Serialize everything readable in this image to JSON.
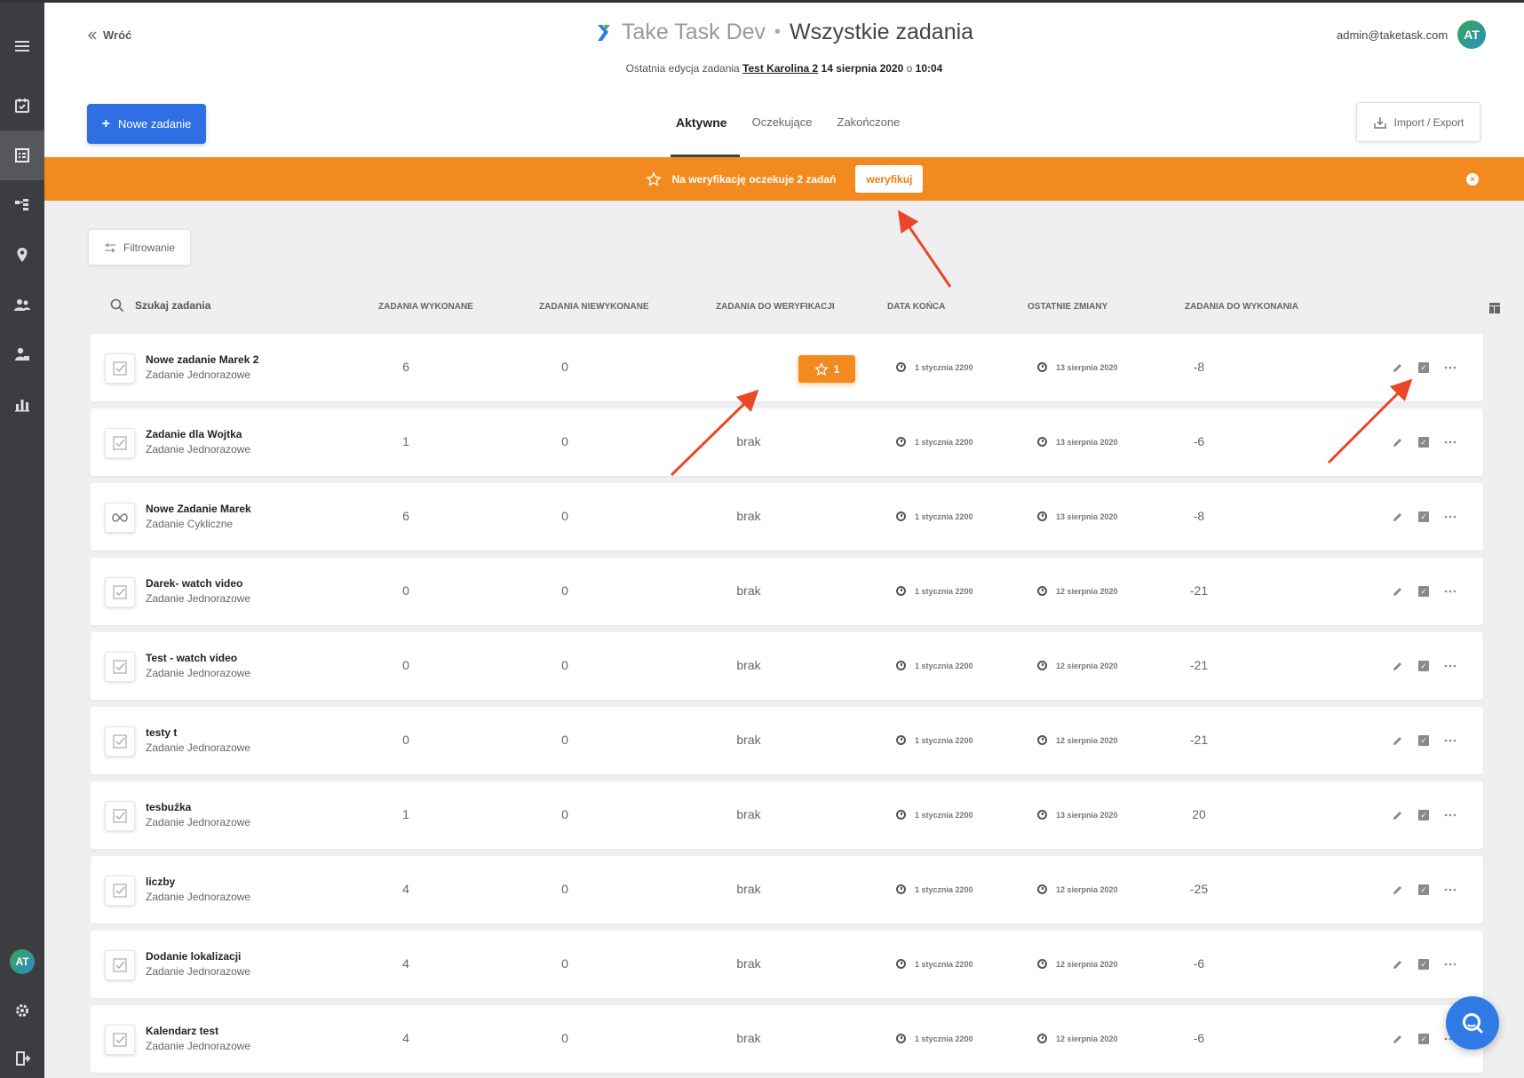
{
  "header": {
    "back_label": "Wróć",
    "app_name": "Take Task Dev",
    "separator": "•",
    "page_title": "Wszystkie zadania",
    "subtitle_prefix": "Ostatnia edycja zadania",
    "subtitle_link": "Test Karolina 2",
    "subtitle_date": "14 sierpnia 2020",
    "subtitle_o": "o",
    "subtitle_time": "10:04",
    "user_email": "admin@taketask.com",
    "user_initials": "AT"
  },
  "toolbar": {
    "new_task_label": "Nowe zadanie",
    "import_export_label": "Import / Export"
  },
  "tabs": [
    {
      "label": "Aktywne",
      "active": true
    },
    {
      "label": "Oczekujące",
      "active": false
    },
    {
      "label": "Zakończone",
      "active": false
    }
  ],
  "banner": {
    "message": "Na weryfikację oczekuje 2 zadań",
    "verify_label": "weryfikuj",
    "color": "#f28a20"
  },
  "filter": {
    "label": "Filtrowanie"
  },
  "table": {
    "search_label": "Szukaj zadania",
    "columns": [
      "Zadania wykonane",
      "Zadania niewykonane",
      "Zadania do weryfikacji",
      "Data końca",
      "Ostatnie zmiany",
      "Zadania do wykonania"
    ],
    "rows": [
      {
        "name": "Nowe zadanie Marek 2",
        "type": "Zadanie Jednorazowe",
        "icon": "checkbox-icon",
        "done": "6",
        "undone": "0",
        "verify": "1",
        "end": "1 stycznia 2200",
        "changed": "13 sierpnia 2020",
        "todo": "-8"
      },
      {
        "name": "Zadanie dla Wojtka",
        "type": "Zadanie Jednorazowe",
        "icon": "checkbox-icon",
        "done": "1",
        "undone": "0",
        "verify": "brak",
        "end": "1 stycznia 2200",
        "changed": "13 sierpnia 2020",
        "todo": "-6"
      },
      {
        "name": "Nowe Zadanie Marek",
        "type": "Zadanie Cykliczne",
        "icon": "infinity-icon",
        "done": "6",
        "undone": "0",
        "verify": "brak",
        "end": "1 stycznia 2200",
        "changed": "13 sierpnia 2020",
        "todo": "-8"
      },
      {
        "name": "Darek- watch video",
        "type": "Zadanie Jednorazowe",
        "icon": "checkbox-icon",
        "done": "0",
        "undone": "0",
        "verify": "brak",
        "end": "1 stycznia 2200",
        "changed": "12 sierpnia 2020",
        "todo": "-21"
      },
      {
        "name": "Test - watch video",
        "type": "Zadanie Jednorazowe",
        "icon": "checkbox-icon",
        "done": "0",
        "undone": "0",
        "verify": "brak",
        "end": "1 stycznia 2200",
        "changed": "12 sierpnia 2020",
        "todo": "-21"
      },
      {
        "name": "testy t",
        "type": "Zadanie Jednorazowe",
        "icon": "checkbox-icon",
        "done": "0",
        "undone": "0",
        "verify": "brak",
        "end": "1 stycznia 2200",
        "changed": "12 sierpnia 2020",
        "todo": "-21"
      },
      {
        "name": "tesbuźka",
        "type": "Zadanie Jednorazowe",
        "icon": "checkbox-icon",
        "done": "1",
        "undone": "0",
        "verify": "brak",
        "end": "1 stycznia 2200",
        "changed": "13 sierpnia 2020",
        "todo": "20"
      },
      {
        "name": "liczby",
        "type": "Zadanie Jednorazowe",
        "icon": "checkbox-icon",
        "done": "4",
        "undone": "0",
        "verify": "brak",
        "end": "1 stycznia 2200",
        "changed": "12 sierpnia 2020",
        "todo": "-25"
      },
      {
        "name": "Dodanie lokalizacji",
        "type": "Zadanie Jednorazowe",
        "icon": "checkbox-icon",
        "done": "4",
        "undone": "0",
        "verify": "brak",
        "end": "1 stycznia 2200",
        "changed": "12 sierpnia 2020",
        "todo": "-6"
      },
      {
        "name": "Kalendarz test",
        "type": "Zadanie Jednorazowe",
        "icon": "checkbox-icon",
        "done": "4",
        "undone": "0",
        "verify": "brak",
        "end": "1 stycznia 2200",
        "changed": "12 sierpnia 2020",
        "todo": "-6"
      }
    ]
  },
  "sidebar": {
    "items": [
      {
        "icon": "menu-icon"
      },
      {
        "icon": "calendar-check-icon"
      },
      {
        "icon": "task-list-icon",
        "active": true
      },
      {
        "icon": "hierarchy-icon"
      },
      {
        "icon": "location-pin-icon"
      },
      {
        "icon": "users-icon"
      },
      {
        "icon": "user-settings-icon"
      },
      {
        "icon": "reports-icon"
      }
    ],
    "user_initials": "AT",
    "bottom_icons": [
      "gear-icon",
      "logout-icon"
    ]
  },
  "colors": {
    "accent": "#2f6fe4",
    "banner": "#f28a20",
    "sidebar": "#3b3d40",
    "annotation_arrow": "#e8472a"
  }
}
